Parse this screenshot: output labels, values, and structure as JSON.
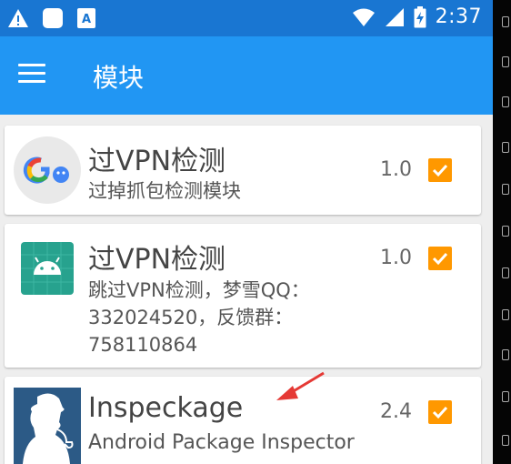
{
  "status_bar": {
    "time": "2:37",
    "left_icons": [
      "warning-icon",
      "notification-square-icon",
      "app-a-icon"
    ],
    "right_icons": [
      "wifi-icon",
      "signal-icon",
      "battery-charging-icon"
    ]
  },
  "app_bar": {
    "title": "模块"
  },
  "modules": [
    {
      "name": "过VPN检测",
      "description": [
        "过掉抓包检测模块"
      ],
      "version": "1.0",
      "enabled": true,
      "icon": "google-go-icon"
    },
    {
      "name": "过VPN检测",
      "description": [
        "跳过VPN检测，梦雪QQ：",
        "332024520，反馈群：",
        "758110864"
      ],
      "version": "1.0",
      "enabled": true,
      "icon": "android-icon"
    },
    {
      "name": "Inspeckage",
      "description": [
        "Android Package Inspector"
      ],
      "version": "2.4",
      "enabled": true,
      "icon": "sherlock-icon"
    }
  ],
  "colors": {
    "app_bar": "#2196f3",
    "status_bar": "#1976d2",
    "checkbox": "#ff9800",
    "annotation": "#e53935"
  }
}
